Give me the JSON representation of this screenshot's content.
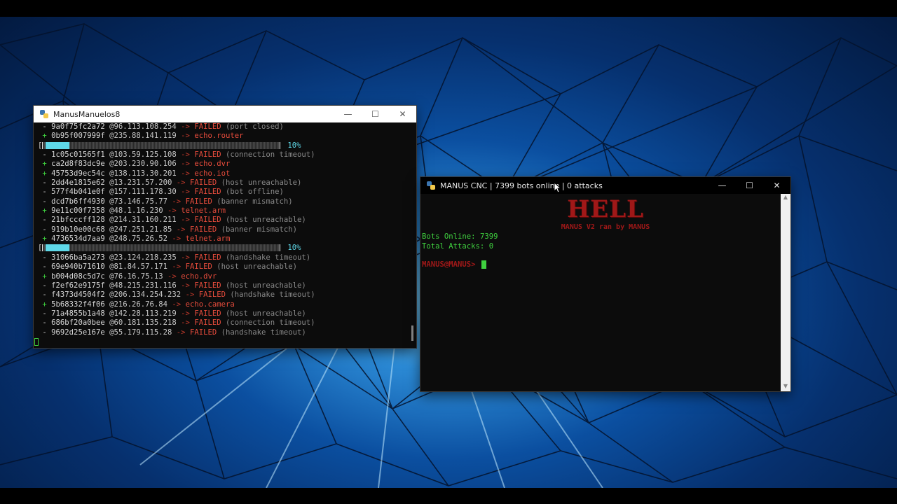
{
  "windows": {
    "scanner": {
      "title": "ManusManuelos8",
      "lines": [
        {
          "sym": "-",
          "id": "9a0f75fc2a72",
          "ip": "@96.113.108.254",
          "arrow": "->",
          "status": "FAILED",
          "reason": "(port closed)"
        },
        {
          "sym": "+",
          "id": "0b95f007999f",
          "ip": "@235.88.141.119",
          "arrow": "->",
          "status": "echo.router",
          "reason": ""
        },
        {
          "progress": true,
          "value": 0.1,
          "label": "10%"
        },
        {
          "sym": "-",
          "id": "1c05c01565f1",
          "ip": "@103.59.125.108",
          "arrow": "->",
          "status": "FAILED",
          "reason": "(connection timeout)"
        },
        {
          "sym": "+",
          "id": "ca2d8f83dc9e",
          "ip": "@203.230.90.106",
          "arrow": "->",
          "status": "echo.dvr",
          "reason": ""
        },
        {
          "sym": "+",
          "id": "45753d9ec54c",
          "ip": "@138.113.30.201",
          "arrow": "->",
          "status": "echo.iot",
          "reason": ""
        },
        {
          "sym": "-",
          "id": "2dd4e1815e62",
          "ip": "@13.231.57.200",
          "arrow": "->",
          "status": "FAILED",
          "reason": "(host unreachable)"
        },
        {
          "sym": "-",
          "id": "577f4b041e0f",
          "ip": "@157.111.178.30",
          "arrow": "->",
          "status": "FAILED",
          "reason": "(bot offline)"
        },
        {
          "sym": "-",
          "id": "dcd7b6ff4930",
          "ip": "@73.146.75.77",
          "arrow": "->",
          "status": "FAILED",
          "reason": "(banner mismatch)"
        },
        {
          "sym": "+",
          "id": "9e11c00f7358",
          "ip": "@48.1.16.230",
          "arrow": "->",
          "status": "telnet.arm",
          "reason": ""
        },
        {
          "sym": "-",
          "id": "21bfcccff128",
          "ip": "@214.31.160.211",
          "arrow": "->",
          "status": "FAILED",
          "reason": "(host unreachable)"
        },
        {
          "sym": "-",
          "id": "919b10e00c68",
          "ip": "@247.251.21.85",
          "arrow": "->",
          "status": "FAILED",
          "reason": "(banner mismatch)"
        },
        {
          "sym": "+",
          "id": "4736534d7aa9",
          "ip": "@248.75.26.52",
          "arrow": "->",
          "status": "telnet.arm",
          "reason": ""
        },
        {
          "progress": true,
          "value": 0.1,
          "label": "10%"
        },
        {
          "sym": "-",
          "id": "31066ba5a273",
          "ip": "@23.124.218.235",
          "arrow": "->",
          "status": "FAILED",
          "reason": "(handshake timeout)"
        },
        {
          "sym": "-",
          "id": "69e940b71610",
          "ip": "@81.84.57.171",
          "arrow": "->",
          "status": "FAILED",
          "reason": "(host unreachable)"
        },
        {
          "sym": "+",
          "id": "b004d08c5d7c",
          "ip": "@76.16.75.13",
          "arrow": "->",
          "status": "echo.dvr",
          "reason": ""
        },
        {
          "sym": "-",
          "id": "f2ef62e9175f",
          "ip": "@48.215.231.116",
          "arrow": "->",
          "status": "FAILED",
          "reason": "(host unreachable)"
        },
        {
          "sym": "-",
          "id": "f4373d4504f2",
          "ip": "@206.134.254.232",
          "arrow": "->",
          "status": "FAILED",
          "reason": "(handshake timeout)"
        },
        {
          "sym": "+",
          "id": "5b68332f4f06",
          "ip": "@216.26.76.84",
          "arrow": "->",
          "status": "echo.camera",
          "reason": ""
        },
        {
          "sym": "-",
          "id": "71a4855b1a48",
          "ip": "@142.28.113.219",
          "arrow": "->",
          "status": "FAILED",
          "reason": "(host unreachable)"
        },
        {
          "sym": "-",
          "id": "686bf20a0bee",
          "ip": "@60.181.135.218",
          "arrow": "->",
          "status": "FAILED",
          "reason": "(connection timeout)"
        },
        {
          "sym": "-",
          "id": "9692d25e167e",
          "ip": "@55.179.115.28",
          "arrow": "->",
          "status": "FAILED",
          "reason": "(handshake timeout)"
        }
      ]
    },
    "cnc": {
      "title": "MANUS CNC | 7399 bots online | 0 attacks",
      "banner_title": "HELL",
      "banner_sub": "MANUS V2 ran by MANUS",
      "bots_online_label": "Bots Online:",
      "bots_online_value": "7399",
      "total_attacks_label": "Total Attacks:",
      "total_attacks_value": "0",
      "prompt": "MANUS@MANUS>"
    }
  },
  "colors": {
    "accent_green": "#3fd13f",
    "failed_red": "#e74c3c",
    "progress_cyan": "#5fd8e8",
    "banner_red": "#a01818"
  },
  "icons": {
    "window_icon": "python-icon",
    "minimize": "minimize-icon",
    "maximize": "maximize-icon",
    "close": "close-icon"
  }
}
